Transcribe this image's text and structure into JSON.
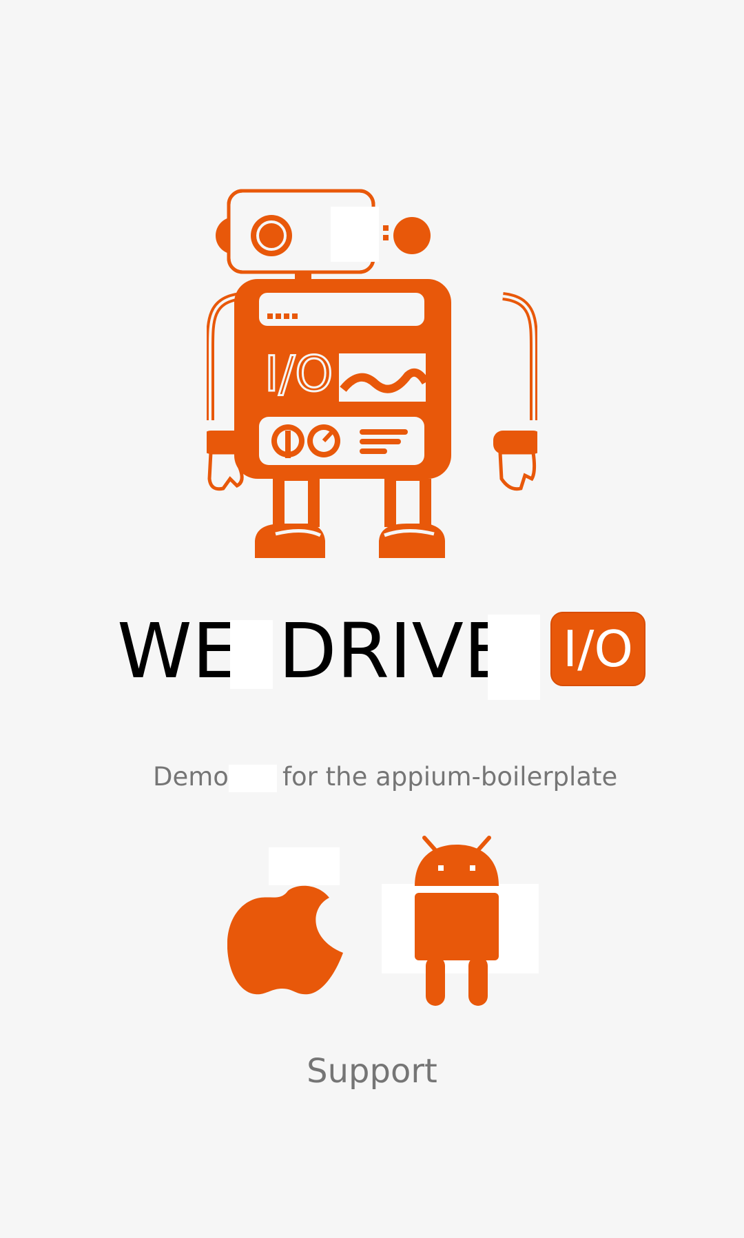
{
  "title": {
    "word1": "WE",
    "word2": "DRIVE",
    "badge": "I/O"
  },
  "robot": {
    "chest_text": "I/O"
  },
  "subtitle": {
    "part1": "Demo",
    "part2": "for the appium-boilerplate"
  },
  "platforms": {
    "ios_icon": "apple-icon",
    "android_icon": "android-icon"
  },
  "support_label": "Support",
  "colors": {
    "accent": "#e8580a",
    "background": "#f6f6f6",
    "text_primary": "#000000",
    "text_secondary": "#757575"
  }
}
